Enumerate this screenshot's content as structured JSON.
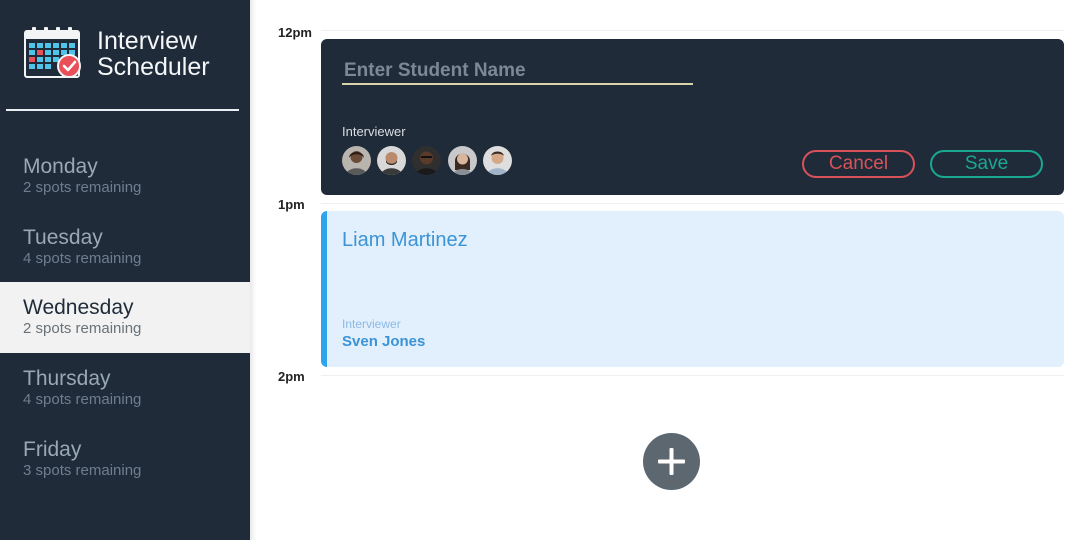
{
  "app": {
    "title_line1": "Interview",
    "title_line2": "Scheduler",
    "logo_icon": "calendar-check-icon"
  },
  "sidebar": {
    "days": [
      {
        "name": "Monday",
        "spots": "2 spots remaining",
        "selected": false
      },
      {
        "name": "Tuesday",
        "spots": "4 spots remaining",
        "selected": false
      },
      {
        "name": "Wednesday",
        "spots": "2 spots remaining",
        "selected": true
      },
      {
        "name": "Thursday",
        "spots": "4 spots remaining",
        "selected": false
      },
      {
        "name": "Friday",
        "spots": "3 spots remaining",
        "selected": false
      }
    ]
  },
  "schedule": {
    "times": [
      "12pm",
      "1pm",
      "2pm"
    ],
    "form": {
      "student_value": "",
      "student_placeholder": "Enter Student Name",
      "interviewer_label": "Interviewer",
      "interviewer_avatars": [
        "avatar-1",
        "avatar-2",
        "avatar-3",
        "avatar-4",
        "avatar-5"
      ],
      "cancel_label": "Cancel",
      "save_label": "Save"
    },
    "appointment": {
      "student": "Liam Martinez",
      "interviewer_label": "Interviewer",
      "interviewer": "Sven Jones"
    },
    "add_icon": "plus-icon"
  },
  "colors": {
    "sidebar_bg": "#1f2b39",
    "selected_bg": "#f2f2f2",
    "cancel": "#d9525a",
    "save": "#1aa891",
    "appointment_accent": "#2ea3ee",
    "appointment_bg": "#e2effc",
    "add_button": "#5c6770"
  }
}
